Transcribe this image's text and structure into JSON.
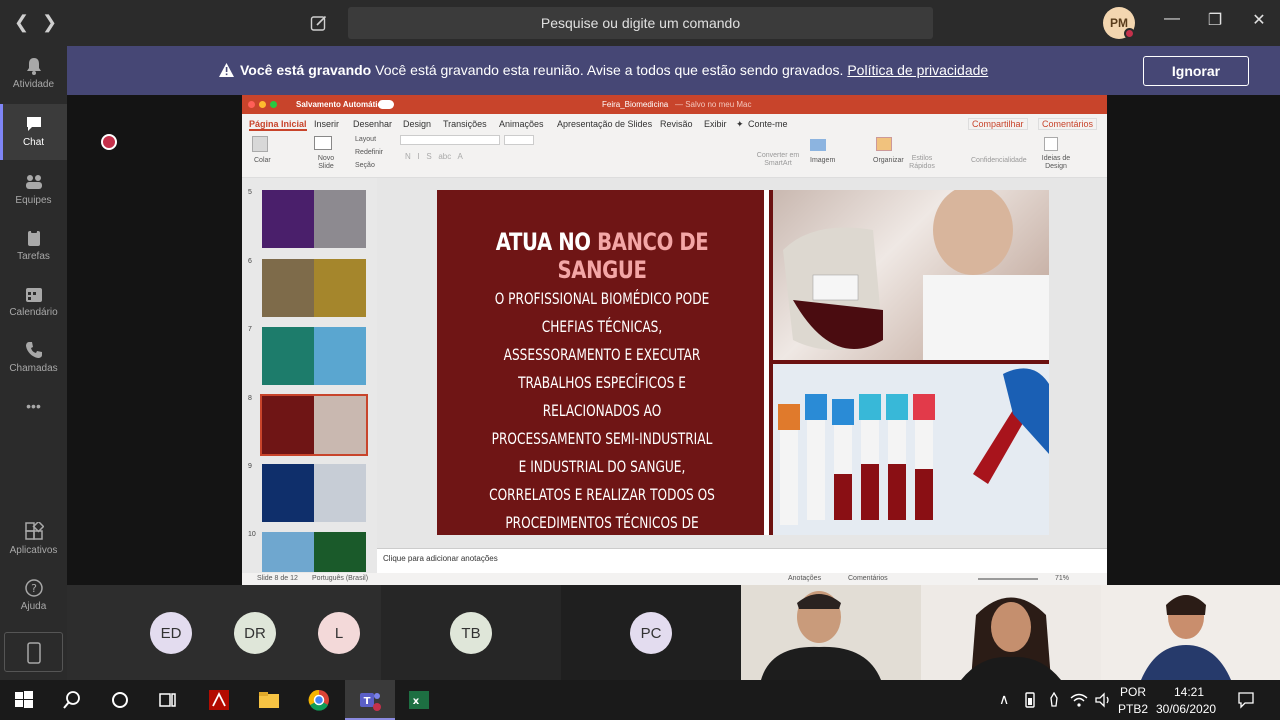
{
  "topbar": {
    "search_placeholder": "Pesquise ou digite um comando",
    "avatar_initials": "PM",
    "minimize": "—",
    "restore": "❐",
    "close": "✕"
  },
  "rail": {
    "items": [
      {
        "label": "Atividade",
        "icon": "bell-icon"
      },
      {
        "label": "Chat",
        "icon": "chat-icon"
      },
      {
        "label": "Equipes",
        "icon": "teams-icon"
      },
      {
        "label": "Tarefas",
        "icon": "tasks-icon"
      },
      {
        "label": "Calendário",
        "icon": "calendar-icon"
      },
      {
        "label": "Chamadas",
        "icon": "phone-icon"
      },
      {
        "label": "Aplicativos",
        "icon": "apps-icon"
      },
      {
        "label": "Ajuda",
        "icon": "help-icon"
      }
    ],
    "more": "•••"
  },
  "banner": {
    "bold": "Você está gravando",
    "text": "Você está gravando esta reunião. Avise a todos que estão sendo gravados.",
    "link": "Política de privacidade",
    "button": "Ignorar"
  },
  "ppt": {
    "autosave": "Salvamento Automático",
    "filename": "Feira_Biomedicina",
    "saved": "— Salvo no meu Mac",
    "tabs": [
      "Página Inicial",
      "Inserir",
      "Desenhar",
      "Design",
      "Transições",
      "Animações",
      "Apresentação de Slides",
      "Revisão",
      "Exibir",
      "Conte-me"
    ],
    "share": "Compartilhar",
    "comments": "Comentários",
    "ribbon": {
      "colar": "Colar",
      "novo_slide": "Novo Slide",
      "layout": "Layout",
      "redefinir": "Redefinir",
      "secao": "Seção",
      "converter": "Converter em SmartArt",
      "imagem": "Imagem",
      "organizar": "Organizar",
      "estilos": "Estilos Rápidos",
      "confidencialidade": "Confidencialidade",
      "ideias": "Ideias de Design"
    },
    "thumbs": [
      "5",
      "6",
      "7",
      "8",
      "9",
      "10"
    ],
    "notes": "Clique para adicionar anotações",
    "status": {
      "slide": "Slide 8 de 12",
      "lang": "Português (Brasil)",
      "anotacoes": "Anotações",
      "comentarios": "Comentários",
      "zoom": "71%"
    }
  },
  "slide": {
    "title_a": "ATUA NO ",
    "title_b": "BANCO DE SANGUE",
    "body": "O PROFISSIONAL BIOMÉDICO PODE CHEFIAS TÉCNICAS, ASSESSORAMENTO E EXECUTAR TRABALHOS ESPECÍFICOS E RELACIONADOS AO PROCESSAMENTO SEMI-INDUSTRIAL E INDUSTRIAL DO SANGUE, CORRELATOS E REALIZAR TODOS OS PROCEDIMENTOS TÉCNICOS DE BANCO DE SANGUE, TRANSFUSÃO, INFUSÃO DE SANGUE, HEMOCOMPONENTES E HEMODERIVADOS;"
  },
  "participants": [
    {
      "initials": "ED",
      "color": "#e3dcef"
    },
    {
      "initials": "DR",
      "color": "#dfe6d9"
    },
    {
      "initials": "L",
      "color": "#f3d9d9"
    },
    {
      "initials": "TB",
      "color": "#dfe6d9"
    },
    {
      "initials": "PC",
      "color": "#e3dcef"
    }
  ],
  "taskbar": {
    "lang1": "POR",
    "lang2": "PTB2",
    "time": "14:21",
    "date": "30/06/2020"
  },
  "colors": {
    "teams_purple": "#464775",
    "ppt_orange": "#c8442b",
    "slide_red": "#6f1515",
    "record_red": "#c4314b"
  }
}
